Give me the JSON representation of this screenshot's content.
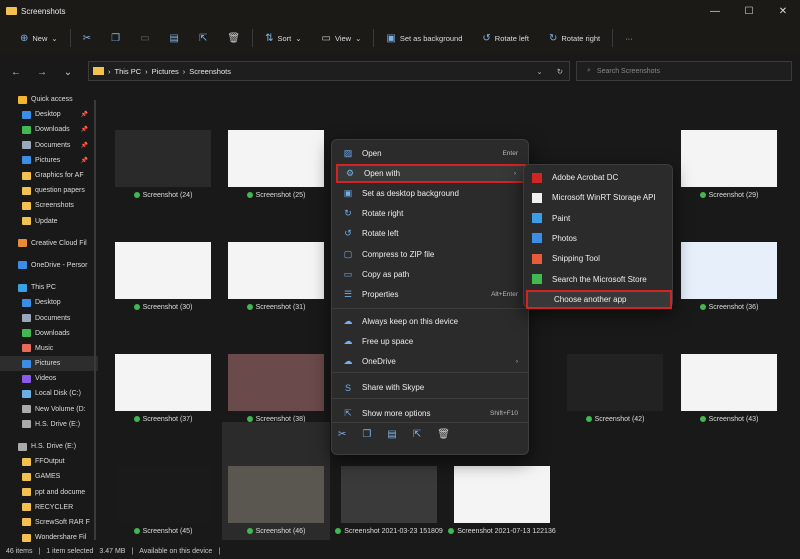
{
  "window": {
    "title": "Screenshots",
    "controls": [
      "—",
      "☐",
      "✕"
    ]
  },
  "toolbar": {
    "new": "New",
    "sort": "Sort",
    "view": "View",
    "set_bg": "Set as background",
    "rotate_left": "Rotate left",
    "rotate_right": "Rotate right",
    "more": "···"
  },
  "nav": {
    "breadcrumb": [
      "This PC",
      "Pictures",
      "Screenshots"
    ],
    "search_placeholder": "Search Screenshots"
  },
  "sidebar": {
    "items": [
      {
        "label": "Quick access",
        "color": "#f2b632",
        "indent": 0
      },
      {
        "label": "Desktop",
        "color": "#3a8ee6",
        "indent": 1,
        "pin": true
      },
      {
        "label": "Downloads",
        "color": "#3fb950",
        "indent": 1,
        "pin": true
      },
      {
        "label": "Documents",
        "color": "#9aa8bb",
        "indent": 1,
        "pin": true
      },
      {
        "label": "Pictures",
        "color": "#3a8ee6",
        "indent": 1,
        "pin": true
      },
      {
        "label": "Graphics for AF",
        "color": "#f2c14e",
        "indent": 1
      },
      {
        "label": "question papers",
        "color": "#f2c14e",
        "indent": 1
      },
      {
        "label": "Screenshots",
        "color": "#f2c14e",
        "indent": 1
      },
      {
        "label": "Update",
        "color": "#f2c14e",
        "indent": 1
      },
      {
        "label": "Creative Cloud Fil",
        "color": "#e88a3a",
        "indent": 0
      },
      {
        "label": "OneDrive - Persor",
        "color": "#3a8ee6",
        "indent": 0
      },
      {
        "label": "This PC",
        "color": "#3aa0e6",
        "indent": 0
      },
      {
        "label": "Desktop",
        "color": "#3a8ee6",
        "indent": 1
      },
      {
        "label": "Documents",
        "color": "#9aa8bb",
        "indent": 1
      },
      {
        "label": "Downloads",
        "color": "#3fb950",
        "indent": 1
      },
      {
        "label": "Music",
        "color": "#e86a5a",
        "indent": 1
      },
      {
        "label": "Pictures",
        "color": "#3a8ee6",
        "indent": 1,
        "selected": true
      },
      {
        "label": "Videos",
        "color": "#8a5ae8",
        "indent": 1
      },
      {
        "label": "Local Disk (C:)",
        "color": "#6ab0e8",
        "indent": 1
      },
      {
        "label": "New Volume (D:",
        "color": "#aaaaaa",
        "indent": 1
      },
      {
        "label": "H.S. Drive (E:)",
        "color": "#aaaaaa",
        "indent": 1
      },
      {
        "label": "H.S. Drive (E:)",
        "color": "#aaaaaa",
        "indent": 0
      },
      {
        "label": "FFOutput",
        "color": "#f2c14e",
        "indent": 1
      },
      {
        "label": "GAMES",
        "color": "#f2c14e",
        "indent": 1
      },
      {
        "label": "ppt and docume",
        "color": "#f2c14e",
        "indent": 1
      },
      {
        "label": "RECYCLER",
        "color": "#f2c14e",
        "indent": 1
      },
      {
        "label": "ScrewSoft RAR F",
        "color": "#f2c14e",
        "indent": 1
      },
      {
        "label": "Wondershare Fil",
        "color": "#f2c14e",
        "indent": 1
      }
    ]
  },
  "files": [
    {
      "label": "Screenshot (24)",
      "row": 0,
      "col": 0,
      "thumb": "#2a2a2a"
    },
    {
      "label": "Screenshot (25)",
      "row": 0,
      "col": 1,
      "thumb": "#f4f4f4"
    },
    {
      "label": "Screenshot (29)",
      "row": 0,
      "col": 5,
      "thumb": "#f4f4f4"
    },
    {
      "label": "Screenshot (30)",
      "row": 1,
      "col": 0,
      "thumb": "#f4f4f4"
    },
    {
      "label": "Screenshot (31)",
      "row": 1,
      "col": 1,
      "thumb": "#f4f4f4"
    },
    {
      "label": "Screenshot (36)",
      "row": 1,
      "col": 5,
      "thumb": "#e6effa"
    },
    {
      "label": "Screenshot (37)",
      "row": 2,
      "col": 0,
      "thumb": "#f4f4f4"
    },
    {
      "label": "Screenshot (38)",
      "row": 2,
      "col": 1,
      "thumb": "#6a4a4a"
    },
    {
      "label": "Screenshot (42)",
      "row": 2,
      "col": 4,
      "thumb": "#222222"
    },
    {
      "label": "Screenshot (43)",
      "row": 2,
      "col": 5,
      "thumb": "#f4f4f4"
    },
    {
      "label": "Screenshot (45)",
      "row": 3,
      "col": 0,
      "thumb": "#1a1a1a"
    },
    {
      "label": "Screenshot (46)",
      "row": 3,
      "col": 1,
      "thumb": "#5a5650",
      "selected": true
    },
    {
      "label": "Screenshot 2021-03-23 151809",
      "row": 3,
      "col": 2,
      "thumb": "#3a3a3a"
    },
    {
      "label": "Screenshot 2021-07-13 122136",
      "row": 3,
      "col": 3,
      "thumb": "#f4f4f4"
    }
  ],
  "context_menu": {
    "items": [
      {
        "label": "Open",
        "icon": "photo-icon",
        "shortcut": "Enter"
      },
      {
        "label": "Open with",
        "icon": "open-with-icon",
        "arrow": "›",
        "highlighted": true
      },
      {
        "label": "Set as desktop background",
        "icon": "desktop-icon"
      },
      {
        "label": "Rotate right",
        "icon": "rotate-right-icon"
      },
      {
        "label": "Rotate left",
        "icon": "rotate-left-icon"
      },
      {
        "label": "Compress to ZIP file",
        "icon": "zip-icon"
      },
      {
        "label": "Copy as path",
        "icon": "copy-path-icon"
      },
      {
        "label": "Properties",
        "icon": "properties-icon",
        "shortcut": "Alt+Enter"
      },
      {
        "label": "Always keep on this device",
        "icon": "cloud-sync-icon"
      },
      {
        "label": "Free up space",
        "icon": "cloud-icon"
      },
      {
        "label": "OneDrive",
        "icon": "onedrive-icon",
        "arrow": "›"
      },
      {
        "label": "Share with Skype",
        "icon": "skype-icon"
      },
      {
        "label": "Show more options",
        "icon": "more-options-icon",
        "shortcut": "Shift+F10"
      }
    ]
  },
  "submenu": {
    "items": [
      {
        "label": "Adobe Acrobat DC",
        "color": "#d32424"
      },
      {
        "label": "Microsoft WinRT Storage API",
        "color": "#f0f0f0"
      },
      {
        "label": "Paint",
        "color": "#3a9ee6"
      },
      {
        "label": "Photos",
        "color": "#3a8ee6"
      },
      {
        "label": "Snipping Tool",
        "color": "#e85a3a"
      },
      {
        "label": "Search the Microsoft Store",
        "color": "#3fb950"
      },
      {
        "label": "Choose another app",
        "highlighted": true
      }
    ]
  },
  "status": {
    "count": "46 items",
    "selected": "1 item selected",
    "size": "3.47 MB",
    "availability": "Available on this device"
  },
  "accent": "#d32424"
}
